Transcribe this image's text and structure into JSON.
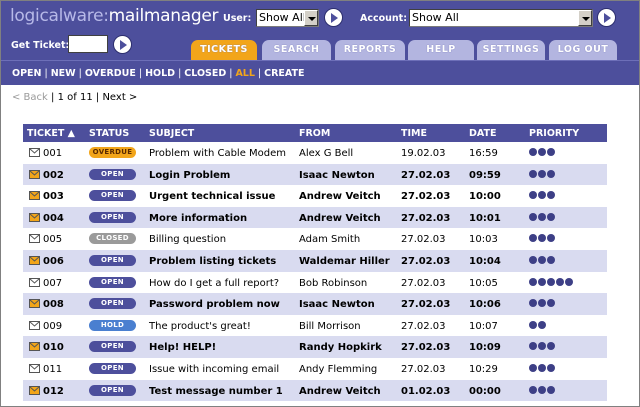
{
  "header": {
    "logo_part1": "logicalware:",
    "logo_part2": "mailmanager",
    "user_label": "User:",
    "user_value": "Show All",
    "account_label": "Account:",
    "account_value": "Show All",
    "get_ticket_label": "Get Ticket:",
    "get_ticket_value": ""
  },
  "tabs": [
    {
      "label": "TICKETS",
      "active": true
    },
    {
      "label": "SEARCH",
      "active": false
    },
    {
      "label": "REPORTS",
      "active": false
    },
    {
      "label": "HELP",
      "active": false
    },
    {
      "label": "SETTINGS",
      "active": false
    },
    {
      "label": "LOG OUT",
      "active": false
    }
  ],
  "subnav": [
    {
      "label": "OPEN",
      "current": false
    },
    {
      "label": "NEW",
      "current": false
    },
    {
      "label": "OVERDUE",
      "current": false
    },
    {
      "label": "HOLD",
      "current": false
    },
    {
      "label": "CLOSED",
      "current": false
    },
    {
      "label": "ALL",
      "current": true
    },
    {
      "label": "CREATE",
      "current": false
    }
  ],
  "subnav_separator": "|",
  "pager": {
    "back": "< Back",
    "sep": "|",
    "page_info": "1 of 11",
    "next": "Next >"
  },
  "columns": {
    "ticket": "TICKET ▲",
    "status": "STATUS",
    "subject": "SUBJECT",
    "from": "FROM",
    "time": "TIME",
    "date": "DATE",
    "priority": "PRIORITY"
  },
  "rows": [
    {
      "ticket": "001",
      "status": "OVERDUE",
      "subject": "Problem with Cable Modem",
      "from": "Alex G Bell",
      "date": "19.02.03",
      "time": "16:59",
      "priority": 3,
      "unread": false
    },
    {
      "ticket": "002",
      "status": "OPEN",
      "subject": "Login Problem",
      "from": "Isaac Newton",
      "date": "27.02.03",
      "time": "09:59",
      "priority": 3,
      "unread": true
    },
    {
      "ticket": "003",
      "status": "OPEN",
      "subject": "Urgent technical issue",
      "from": "Andrew Veitch",
      "date": "27.02.03",
      "time": "10:00",
      "priority": 3,
      "unread": true
    },
    {
      "ticket": "004",
      "status": "OPEN",
      "subject": "More information",
      "from": "Andrew Veitch",
      "date": "27.02.03",
      "time": "10:01",
      "priority": 3,
      "unread": true
    },
    {
      "ticket": "005",
      "status": "CLOSED",
      "subject": "Billing question",
      "from": "Adam Smith",
      "date": "27.02.03",
      "time": "10:03",
      "priority": 3,
      "unread": false
    },
    {
      "ticket": "006",
      "status": "OPEN",
      "subject": "Problem listing tickets",
      "from": "Waldemar Hiller",
      "date": "27.02.03",
      "time": "10:04",
      "priority": 3,
      "unread": true
    },
    {
      "ticket": "007",
      "status": "OPEN",
      "subject": "How do I get a full report?",
      "from": "Bob Robinson",
      "date": "27.02.03",
      "time": "10:05",
      "priority": 5,
      "unread": false
    },
    {
      "ticket": "008",
      "status": "OPEN",
      "subject": "Password problem now",
      "from": "Isaac Newton",
      "date": "27.02.03",
      "time": "10:06",
      "priority": 3,
      "unread": true
    },
    {
      "ticket": "009",
      "status": "HOLD",
      "subject": "The product's great!",
      "from": "Bill Morrison",
      "date": "27.02.03",
      "time": "10:07",
      "priority": 2,
      "unread": false
    },
    {
      "ticket": "010",
      "status": "OPEN",
      "subject": "Help! HELP!",
      "from": "Randy Hopkirk",
      "date": "27.02.03",
      "time": "10:09",
      "priority": 3,
      "unread": true
    },
    {
      "ticket": "011",
      "status": "OPEN",
      "subject": "Issue with incoming email",
      "from": "Andy Flemming",
      "date": "27.02.03",
      "time": "10:29",
      "priority": 3,
      "unread": false
    },
    {
      "ticket": "012",
      "status": "OPEN",
      "subject": "Test message number 1",
      "from": "Andrew Veitch",
      "date": "01.02.03",
      "time": "00:00",
      "priority": 3,
      "unread": true
    }
  ],
  "colors": {
    "brand": "#4d4f9c",
    "accent": "#f2a51a",
    "row_alt": "#d9dbf0"
  }
}
